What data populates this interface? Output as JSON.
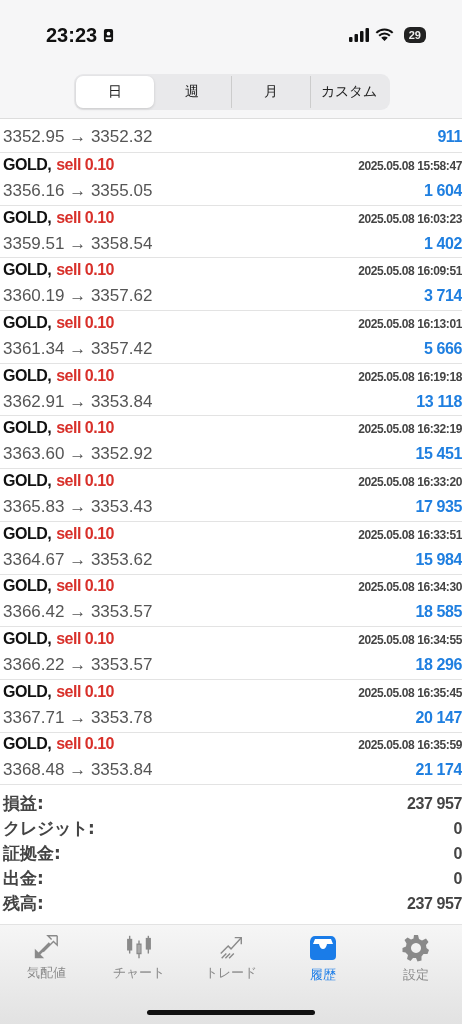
{
  "status_bar": {
    "time": "23:23",
    "battery": "29"
  },
  "period_tabs": [
    {
      "label": "日",
      "selected": true
    },
    {
      "label": "週",
      "selected": false
    },
    {
      "label": "月",
      "selected": false
    },
    {
      "label": "カスタム",
      "selected": false
    }
  ],
  "first_row_partial": {
    "prices": "3352.95 → 3352.32",
    "profit": "911"
  },
  "deals": [
    {
      "symbol": "GOLD,",
      "order": "sell 0.10",
      "time": "2025.05.08 15:58:47",
      "prices": "3356.16 → 3355.05",
      "profit": "1 604"
    },
    {
      "symbol": "GOLD,",
      "order": "sell 0.10",
      "time": "2025.05.08 16:03:23",
      "prices": "3359.51 → 3358.54",
      "profit": "1 402"
    },
    {
      "symbol": "GOLD,",
      "order": "sell 0.10",
      "time": "2025.05.08 16:09:51",
      "prices": "3360.19 → 3357.62",
      "profit": "3 714"
    },
    {
      "symbol": "GOLD,",
      "order": "sell 0.10",
      "time": "2025.05.08 16:13:01",
      "prices": "3361.34 → 3357.42",
      "profit": "5 666"
    },
    {
      "symbol": "GOLD,",
      "order": "sell 0.10",
      "time": "2025.05.08 16:19:18",
      "prices": "3362.91 → 3353.84",
      "profit": "13 118"
    },
    {
      "symbol": "GOLD,",
      "order": "sell 0.10",
      "time": "2025.05.08 16:32:19",
      "prices": "3363.60 → 3352.92",
      "profit": "15 451"
    },
    {
      "symbol": "GOLD,",
      "order": "sell 0.10",
      "time": "2025.05.08 16:33:20",
      "prices": "3365.83 → 3353.43",
      "profit": "17 935"
    },
    {
      "symbol": "GOLD,",
      "order": "sell 0.10",
      "time": "2025.05.08 16:33:51",
      "prices": "3364.67 → 3353.62",
      "profit": "15 984"
    },
    {
      "symbol": "GOLD,",
      "order": "sell 0.10",
      "time": "2025.05.08 16:34:30",
      "prices": "3366.42 → 3353.57",
      "profit": "18 585"
    },
    {
      "symbol": "GOLD,",
      "order": "sell 0.10",
      "time": "2025.05.08 16:34:55",
      "prices": "3366.22 → 3353.57",
      "profit": "18 296"
    },
    {
      "symbol": "GOLD,",
      "order": "sell 0.10",
      "time": "2025.05.08 16:35:45",
      "prices": "3367.71 → 3353.78",
      "profit": "20 147"
    },
    {
      "symbol": "GOLD,",
      "order": "sell 0.10",
      "time": "2025.05.08 16:35:59",
      "prices": "3368.48 → 3353.84",
      "profit": "21 174"
    }
  ],
  "summary": [
    {
      "label": "損益:",
      "value": "237 957"
    },
    {
      "label": "クレジット:",
      "value": "0"
    },
    {
      "label": "証拠金:",
      "value": "0"
    },
    {
      "label": "出金:",
      "value": "0"
    },
    {
      "label": "残高:",
      "value": "237 957"
    }
  ],
  "bottom_tabs": [
    {
      "kind": "quotes",
      "label": "気配値",
      "selected": false
    },
    {
      "kind": "chart",
      "label": "チャート",
      "selected": false
    },
    {
      "kind": "trade",
      "label": "トレード",
      "selected": false
    },
    {
      "kind": "history",
      "label": "履歴",
      "selected": true
    },
    {
      "kind": "settings",
      "label": "設定",
      "selected": false
    }
  ]
}
